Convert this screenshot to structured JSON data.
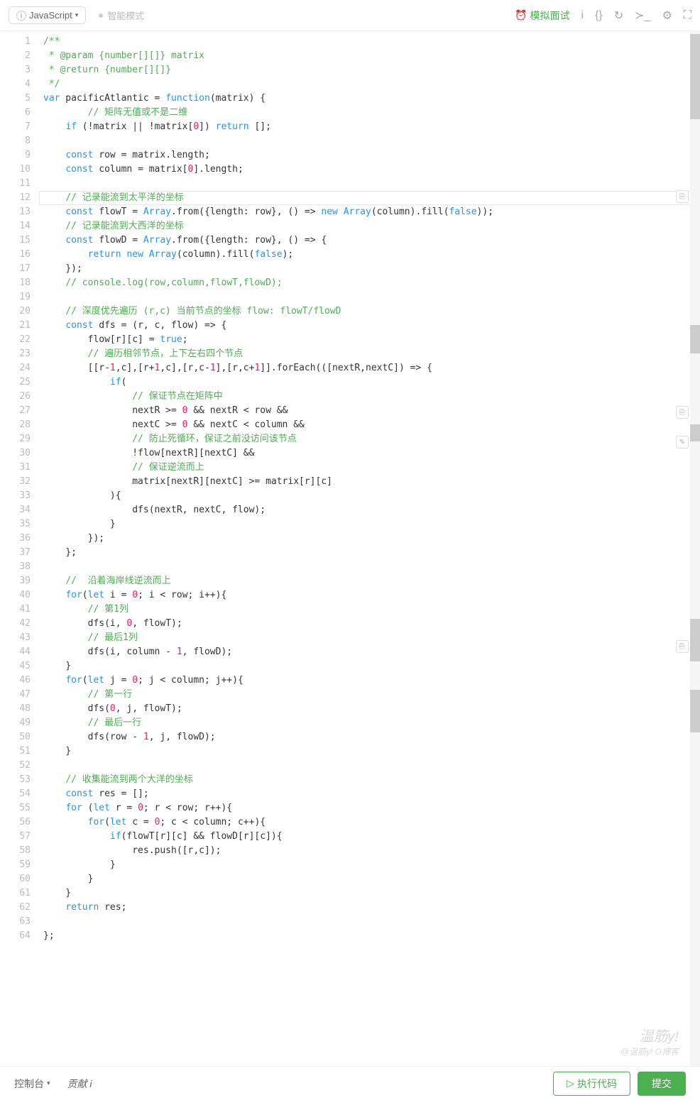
{
  "toolbar": {
    "language": "JavaScript",
    "mode_label": "智能模式",
    "mock_interview": "模拟面试"
  },
  "code_lines": [
    {
      "n": 1,
      "segs": [
        {
          "t": "/**",
          "c": "c-comment"
        }
      ]
    },
    {
      "n": 2,
      "segs": [
        {
          "t": " * @param {number[][]} matrix",
          "c": "c-comment"
        }
      ]
    },
    {
      "n": 3,
      "segs": [
        {
          "t": " * @return {number[][]}",
          "c": "c-comment"
        }
      ]
    },
    {
      "n": 4,
      "segs": [
        {
          "t": " */",
          "c": "c-comment"
        }
      ]
    },
    {
      "n": 5,
      "segs": [
        {
          "t": "var",
          "c": "c-keyword"
        },
        {
          "t": " pacificAtlantic = ",
          "c": "c-plain"
        },
        {
          "t": "function",
          "c": "c-keyword"
        },
        {
          "t": "(matrix) {",
          "c": "c-plain"
        }
      ]
    },
    {
      "n": 6,
      "segs": [
        {
          "t": "        ",
          "c": "c-plain"
        },
        {
          "t": "// 矩阵无值或不是二维",
          "c": "c-comment"
        }
      ]
    },
    {
      "n": 7,
      "segs": [
        {
          "t": "    ",
          "c": "c-plain"
        },
        {
          "t": "if",
          "c": "c-keyword"
        },
        {
          "t": " (!matrix || !matrix[",
          "c": "c-plain"
        },
        {
          "t": "0",
          "c": "c-number"
        },
        {
          "t": "]) ",
          "c": "c-plain"
        },
        {
          "t": "return",
          "c": "c-keyword"
        },
        {
          "t": " [];",
          "c": "c-plain"
        }
      ]
    },
    {
      "n": 8,
      "segs": []
    },
    {
      "n": 9,
      "segs": [
        {
          "t": "    ",
          "c": "c-plain"
        },
        {
          "t": "const",
          "c": "c-keyword"
        },
        {
          "t": " row = matrix.length;",
          "c": "c-plain"
        }
      ]
    },
    {
      "n": 10,
      "segs": [
        {
          "t": "    ",
          "c": "c-plain"
        },
        {
          "t": "const",
          "c": "c-keyword"
        },
        {
          "t": " column = matrix[",
          "c": "c-plain"
        },
        {
          "t": "0",
          "c": "c-number"
        },
        {
          "t": "].length;",
          "c": "c-plain"
        }
      ]
    },
    {
      "n": 11,
      "segs": []
    },
    {
      "n": 12,
      "hl": true,
      "segs": [
        {
          "t": "    ",
          "c": "c-plain"
        },
        {
          "t": "// 记录能流到太平洋的坐标",
          "c": "c-comment"
        }
      ]
    },
    {
      "n": 13,
      "segs": [
        {
          "t": "    ",
          "c": "c-plain"
        },
        {
          "t": "const",
          "c": "c-keyword"
        },
        {
          "t": " flowT = ",
          "c": "c-plain"
        },
        {
          "t": "Array",
          "c": "c-func"
        },
        {
          "t": ".from({length: row}, () => ",
          "c": "c-plain"
        },
        {
          "t": "new",
          "c": "c-keyword"
        },
        {
          "t": " ",
          "c": "c-plain"
        },
        {
          "t": "Array",
          "c": "c-func"
        },
        {
          "t": "(column).fill(",
          "c": "c-plain"
        },
        {
          "t": "false",
          "c": "c-bool"
        },
        {
          "t": "));",
          "c": "c-plain"
        }
      ]
    },
    {
      "n": 14,
      "segs": [
        {
          "t": "    ",
          "c": "c-plain"
        },
        {
          "t": "// 记录能流到大西洋的坐标",
          "c": "c-comment"
        }
      ]
    },
    {
      "n": 15,
      "segs": [
        {
          "t": "    ",
          "c": "c-plain"
        },
        {
          "t": "const",
          "c": "c-keyword"
        },
        {
          "t": " flowD = ",
          "c": "c-plain"
        },
        {
          "t": "Array",
          "c": "c-func"
        },
        {
          "t": ".from({length: row}, () => {",
          "c": "c-plain"
        }
      ]
    },
    {
      "n": 16,
      "segs": [
        {
          "t": "        ",
          "c": "c-plain"
        },
        {
          "t": "return",
          "c": "c-keyword"
        },
        {
          "t": " ",
          "c": "c-plain"
        },
        {
          "t": "new",
          "c": "c-keyword"
        },
        {
          "t": " ",
          "c": "c-plain"
        },
        {
          "t": "Array",
          "c": "c-func"
        },
        {
          "t": "(column).fill(",
          "c": "c-plain"
        },
        {
          "t": "false",
          "c": "c-bool"
        },
        {
          "t": ");",
          "c": "c-plain"
        }
      ]
    },
    {
      "n": 17,
      "segs": [
        {
          "t": "    });",
          "c": "c-plain"
        }
      ]
    },
    {
      "n": 18,
      "segs": [
        {
          "t": "    ",
          "c": "c-plain"
        },
        {
          "t": "// console.log(row,column,flowT,flowD);",
          "c": "c-comment"
        }
      ]
    },
    {
      "n": 19,
      "segs": []
    },
    {
      "n": 20,
      "segs": [
        {
          "t": "    ",
          "c": "c-plain"
        },
        {
          "t": "// 深度优先遍历 (r,c) 当前节点的坐标 flow: flowT/flowD",
          "c": "c-comment"
        }
      ]
    },
    {
      "n": 21,
      "segs": [
        {
          "t": "    ",
          "c": "c-plain"
        },
        {
          "t": "const",
          "c": "c-keyword"
        },
        {
          "t": " dfs = (r, c, flow) => {",
          "c": "c-plain"
        }
      ]
    },
    {
      "n": 22,
      "segs": [
        {
          "t": "        flow[r][c] = ",
          "c": "c-plain"
        },
        {
          "t": "true",
          "c": "c-bool"
        },
        {
          "t": ";",
          "c": "c-plain"
        }
      ]
    },
    {
      "n": 23,
      "segs": [
        {
          "t": "        ",
          "c": "c-plain"
        },
        {
          "t": "// 遍历相邻节点，上下左右四个节点",
          "c": "c-comment"
        }
      ]
    },
    {
      "n": 24,
      "segs": [
        {
          "t": "        [[r-",
          "c": "c-plain"
        },
        {
          "t": "1",
          "c": "c-number"
        },
        {
          "t": ",c],[r+",
          "c": "c-plain"
        },
        {
          "t": "1",
          "c": "c-number"
        },
        {
          "t": ",c],[r,c-",
          "c": "c-plain"
        },
        {
          "t": "1",
          "c": "c-number"
        },
        {
          "t": "],[r,c+",
          "c": "c-plain"
        },
        {
          "t": "1",
          "c": "c-number"
        },
        {
          "t": "]].forEach(([nextR,nextC]) => {",
          "c": "c-plain"
        }
      ]
    },
    {
      "n": 25,
      "segs": [
        {
          "t": "            ",
          "c": "c-plain"
        },
        {
          "t": "if",
          "c": "c-keyword"
        },
        {
          "t": "(",
          "c": "c-plain"
        }
      ]
    },
    {
      "n": 26,
      "segs": [
        {
          "t": "                ",
          "c": "c-plain"
        },
        {
          "t": "// 保证节点在矩阵中",
          "c": "c-comment"
        }
      ]
    },
    {
      "n": 27,
      "segs": [
        {
          "t": "                nextR >= ",
          "c": "c-plain"
        },
        {
          "t": "0",
          "c": "c-number"
        },
        {
          "t": " && nextR < row &&",
          "c": "c-plain"
        }
      ]
    },
    {
      "n": 28,
      "segs": [
        {
          "t": "                nextC >= ",
          "c": "c-plain"
        },
        {
          "t": "0",
          "c": "c-number"
        },
        {
          "t": " && nextC < column &&",
          "c": "c-plain"
        }
      ]
    },
    {
      "n": 29,
      "segs": [
        {
          "t": "                ",
          "c": "c-plain"
        },
        {
          "t": "// 防止死循环，保证之前没访问该节点",
          "c": "c-comment"
        }
      ]
    },
    {
      "n": 30,
      "segs": [
        {
          "t": "                !flow[nextR][nextC] &&",
          "c": "c-plain"
        }
      ]
    },
    {
      "n": 31,
      "segs": [
        {
          "t": "                ",
          "c": "c-plain"
        },
        {
          "t": "// 保证逆流而上",
          "c": "c-comment"
        }
      ]
    },
    {
      "n": 32,
      "segs": [
        {
          "t": "                matrix[nextR][nextC] >= matrix[r][c]",
          "c": "c-plain"
        }
      ]
    },
    {
      "n": 33,
      "segs": [
        {
          "t": "            ){",
          "c": "c-plain"
        }
      ]
    },
    {
      "n": 34,
      "segs": [
        {
          "t": "                dfs(nextR, nextC, flow);",
          "c": "c-plain"
        }
      ]
    },
    {
      "n": 35,
      "segs": [
        {
          "t": "            }",
          "c": "c-plain"
        }
      ]
    },
    {
      "n": 36,
      "segs": [
        {
          "t": "        });",
          "c": "c-plain"
        }
      ]
    },
    {
      "n": 37,
      "segs": [
        {
          "t": "    };",
          "c": "c-plain"
        }
      ]
    },
    {
      "n": 38,
      "segs": []
    },
    {
      "n": 39,
      "segs": [
        {
          "t": "    ",
          "c": "c-plain"
        },
        {
          "t": "//  沿着海岸线逆流而上",
          "c": "c-comment"
        }
      ]
    },
    {
      "n": 40,
      "segs": [
        {
          "t": "    ",
          "c": "c-plain"
        },
        {
          "t": "for",
          "c": "c-keyword"
        },
        {
          "t": "(",
          "c": "c-plain"
        },
        {
          "t": "let",
          "c": "c-keyword"
        },
        {
          "t": " i = ",
          "c": "c-plain"
        },
        {
          "t": "0",
          "c": "c-number"
        },
        {
          "t": "; i < row; i++){",
          "c": "c-plain"
        }
      ]
    },
    {
      "n": 41,
      "segs": [
        {
          "t": "        ",
          "c": "c-plain"
        },
        {
          "t": "// 第1列",
          "c": "c-comment"
        }
      ]
    },
    {
      "n": 42,
      "segs": [
        {
          "t": "        dfs(i, ",
          "c": "c-plain"
        },
        {
          "t": "0",
          "c": "c-number"
        },
        {
          "t": ", flowT);",
          "c": "c-plain"
        }
      ]
    },
    {
      "n": 43,
      "segs": [
        {
          "t": "        ",
          "c": "c-plain"
        },
        {
          "t": "// 最后1列",
          "c": "c-comment"
        }
      ]
    },
    {
      "n": 44,
      "segs": [
        {
          "t": "        dfs(i, column - ",
          "c": "c-plain"
        },
        {
          "t": "1",
          "c": "c-number"
        },
        {
          "t": ", flowD);",
          "c": "c-plain"
        }
      ]
    },
    {
      "n": 45,
      "segs": [
        {
          "t": "    }",
          "c": "c-plain"
        }
      ]
    },
    {
      "n": 46,
      "segs": [
        {
          "t": "    ",
          "c": "c-plain"
        },
        {
          "t": "for",
          "c": "c-keyword"
        },
        {
          "t": "(",
          "c": "c-plain"
        },
        {
          "t": "let",
          "c": "c-keyword"
        },
        {
          "t": " j = ",
          "c": "c-plain"
        },
        {
          "t": "0",
          "c": "c-number"
        },
        {
          "t": "; j < column; j++){",
          "c": "c-plain"
        }
      ]
    },
    {
      "n": 47,
      "segs": [
        {
          "t": "        ",
          "c": "c-plain"
        },
        {
          "t": "// 第一行",
          "c": "c-comment"
        }
      ]
    },
    {
      "n": 48,
      "segs": [
        {
          "t": "        dfs(",
          "c": "c-plain"
        },
        {
          "t": "0",
          "c": "c-number"
        },
        {
          "t": ", j, flowT);",
          "c": "c-plain"
        }
      ]
    },
    {
      "n": 49,
      "segs": [
        {
          "t": "        ",
          "c": "c-plain"
        },
        {
          "t": "// 最后一行",
          "c": "c-comment"
        }
      ]
    },
    {
      "n": 50,
      "segs": [
        {
          "t": "        dfs(row - ",
          "c": "c-plain"
        },
        {
          "t": "1",
          "c": "c-number"
        },
        {
          "t": ", j, flowD);",
          "c": "c-plain"
        }
      ]
    },
    {
      "n": 51,
      "segs": [
        {
          "t": "    }",
          "c": "c-plain"
        }
      ]
    },
    {
      "n": 52,
      "segs": []
    },
    {
      "n": 53,
      "segs": [
        {
          "t": "    ",
          "c": "c-plain"
        },
        {
          "t": "// 收集能流到两个大洋的坐标",
          "c": "c-comment"
        }
      ]
    },
    {
      "n": 54,
      "segs": [
        {
          "t": "    ",
          "c": "c-plain"
        },
        {
          "t": "const",
          "c": "c-keyword"
        },
        {
          "t": " res = [];",
          "c": "c-plain"
        }
      ]
    },
    {
      "n": 55,
      "segs": [
        {
          "t": "    ",
          "c": "c-plain"
        },
        {
          "t": "for",
          "c": "c-keyword"
        },
        {
          "t": " (",
          "c": "c-plain"
        },
        {
          "t": "let",
          "c": "c-keyword"
        },
        {
          "t": " r = ",
          "c": "c-plain"
        },
        {
          "t": "0",
          "c": "c-number"
        },
        {
          "t": "; r < row; r++){",
          "c": "c-plain"
        }
      ]
    },
    {
      "n": 56,
      "segs": [
        {
          "t": "        ",
          "c": "c-plain"
        },
        {
          "t": "for",
          "c": "c-keyword"
        },
        {
          "t": "(",
          "c": "c-plain"
        },
        {
          "t": "let",
          "c": "c-keyword"
        },
        {
          "t": " c = ",
          "c": "c-plain"
        },
        {
          "t": "0",
          "c": "c-number"
        },
        {
          "t": "; c < column; c++){",
          "c": "c-plain"
        }
      ]
    },
    {
      "n": 57,
      "segs": [
        {
          "t": "            ",
          "c": "c-plain"
        },
        {
          "t": "if",
          "c": "c-keyword"
        },
        {
          "t": "(flowT[r][c] && flowD[r][c]){",
          "c": "c-plain"
        }
      ]
    },
    {
      "n": 58,
      "segs": [
        {
          "t": "                res.push([r,c]);",
          "c": "c-plain"
        }
      ]
    },
    {
      "n": 59,
      "segs": [
        {
          "t": "            }",
          "c": "c-plain"
        }
      ]
    },
    {
      "n": 60,
      "segs": [
        {
          "t": "        }",
          "c": "c-plain"
        }
      ]
    },
    {
      "n": 61,
      "segs": [
        {
          "t": "    }",
          "c": "c-plain"
        }
      ]
    },
    {
      "n": 62,
      "segs": [
        {
          "t": "    ",
          "c": "c-plain"
        },
        {
          "t": "return",
          "c": "c-keyword"
        },
        {
          "t": " res;",
          "c": "c-plain"
        }
      ]
    },
    {
      "n": 63,
      "segs": []
    },
    {
      "n": 64,
      "segs": [
        {
          "t": "};",
          "c": "c-plain"
        }
      ]
    }
  ],
  "bottom": {
    "console": "控制台",
    "contribute": "贡献",
    "run": "执行代码",
    "submit": "提交"
  },
  "watermark": {
    "line1": "温筋y!",
    "line2": "@温筋y! O博客"
  }
}
